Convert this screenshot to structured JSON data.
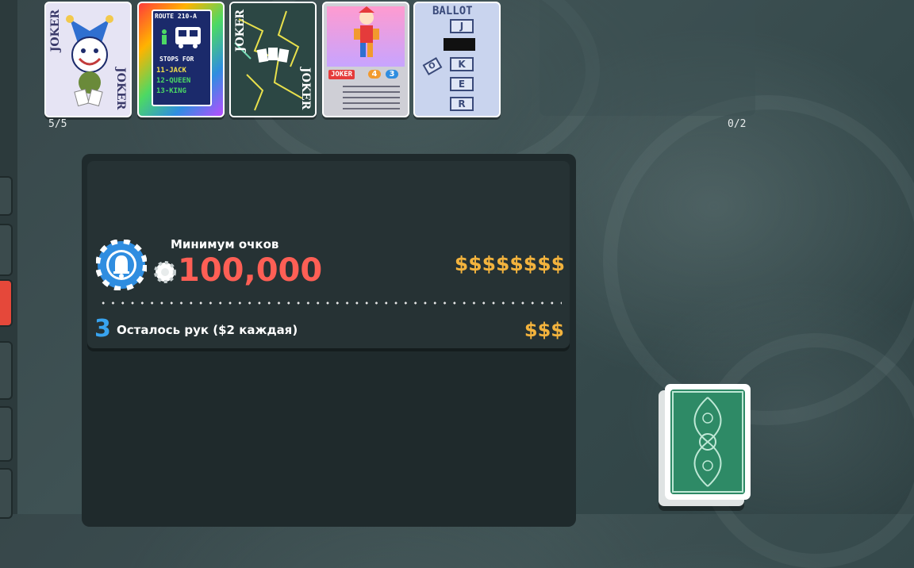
{
  "jokers": {
    "count_label": "5/5",
    "cards": [
      {
        "name": "Joker",
        "side_text": "JOKER",
        "mirror_text": "JOKER"
      },
      {
        "name": "Ride the Bus",
        "title": "ROUTE 210-A",
        "subtitle": "STOPS FOR",
        "lines": [
          "11-JACK",
          "12-QUEEN",
          "13-KING"
        ]
      },
      {
        "name": "Card Sharp",
        "side_text": "JOKER",
        "mirror_text": "JOKER"
      },
      {
        "name": "Misprint style",
        "tag": "JOKER",
        "num1": "4",
        "num2": "3"
      },
      {
        "name": "Ballot",
        "title": "BALLOT",
        "letters": [
          "J",
          "O",
          "K",
          "E",
          "R"
        ]
      }
    ]
  },
  "consumables": {
    "count_label": "0/2"
  },
  "blind": {
    "min_label": "Минимум очков",
    "score": "100,000",
    "reward": "$$$$$$$$",
    "hands_left": "3",
    "hands_text": "Осталось рук ($2 каждая)",
    "hands_reward": "$$$"
  },
  "colors": {
    "score_red": "#fe5f55",
    "money_gold": "#f3b33d",
    "hands_blue": "#38a4f0",
    "chip_blue": "#2f8de0"
  }
}
